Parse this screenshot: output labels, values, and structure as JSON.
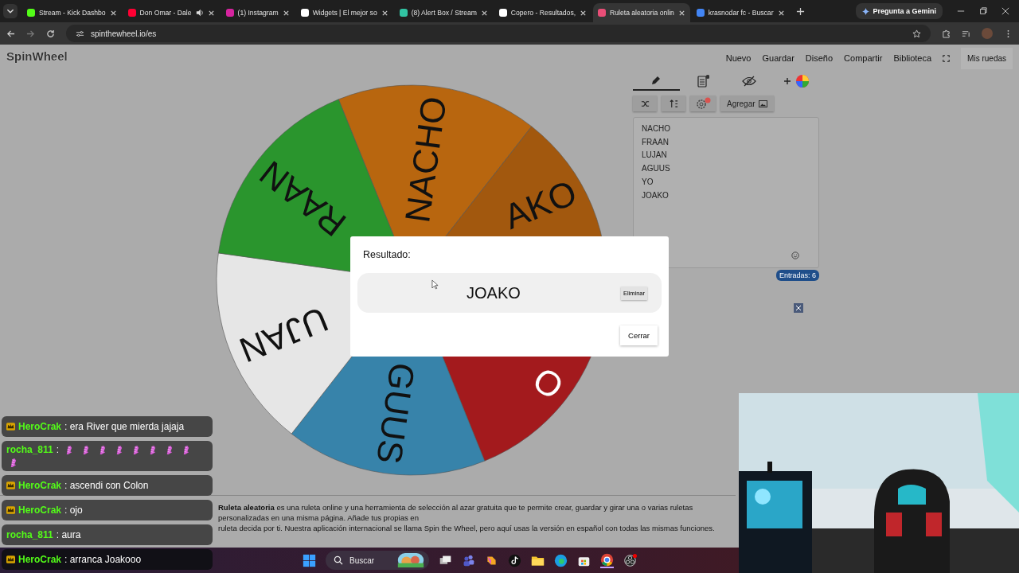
{
  "browser": {
    "tabs": [
      {
        "title": "Stream - Kick Dashbo",
        "selected": false
      },
      {
        "title": "Don Omar - Dale",
        "selected": false,
        "audio": true
      },
      {
        "title": "(1) Instagram",
        "selected": false
      },
      {
        "title": "Widgets | El mejor so",
        "selected": false
      },
      {
        "title": "(8) Alert Box / Stream",
        "selected": false
      },
      {
        "title": "Copero - Resultados,",
        "selected": false
      },
      {
        "title": "Ruleta aleatoria onlin",
        "selected": true
      },
      {
        "title": "krasnodar fc - Buscar",
        "selected": false
      }
    ],
    "gemini": "Pregunta a Gemini",
    "url": "spinthewheel.io/es"
  },
  "site": {
    "logo": "SpinWheel",
    "nav": [
      "Nuevo",
      "Guardar",
      "Diseño",
      "Compartir",
      "Biblioteca"
    ],
    "my_wheels": "Mis ruedas"
  },
  "wheel": {
    "slices": [
      {
        "label": "NACHO",
        "color": "#b8660f"
      },
      {
        "label": "AKO",
        "color": "#a2580e"
      },
      {
        "label": "O",
        "color": "#a31a1d"
      },
      {
        "label": "GUUS",
        "color": "#3783aa"
      },
      {
        "label": "UJAN",
        "color": "#e6e6e6"
      },
      {
        "label": "RAAN",
        "color": "#2a952d"
      }
    ]
  },
  "editor": {
    "add_button": "Agregar",
    "entries": [
      "NACHO",
      "FRAAN",
      "LUJAN",
      "AGUUS",
      "YO",
      "JOAKO"
    ],
    "count": "Entradas: 6"
  },
  "info": {
    "text": "**Ruleta aleatoria** es una ruleta online y una herramienta de selección al azar gratuita que te permite crear, guardar y girar una o varias ruletas personalizadas en una misma página. Añade tus propias en",
    "text2": "ruleta decida por ti. Nuestra aplicación internacional se llama Spin the Wheel, pero aquí usas la versión en español con todas las mismas funciones."
  },
  "dialog": {
    "title": "Resultado:",
    "result": "JOAKO",
    "remove": "Eliminar",
    "close": "Cerrar"
  },
  "chat": [
    {
      "user": "HeroCrak",
      "badge": true,
      "kind": "text",
      "text": ": era River que mierda jajaja"
    },
    {
      "user": "rocha_811",
      "badge": false,
      "kind": "emotes",
      "text": ":"
    },
    {
      "user": "HeroCrak",
      "badge": true,
      "kind": "text",
      "text": ": ascendi con Colon"
    },
    {
      "user": "HeroCrak",
      "badge": true,
      "kind": "text",
      "text": ": ojo"
    },
    {
      "user": "rocha_811",
      "badge": false,
      "kind": "text",
      "text": ": aura"
    },
    {
      "user": "HeroCrak",
      "badge": true,
      "kind": "text",
      "text": ": arranca Joakooo"
    }
  ],
  "taskbar": {
    "search": "Buscar"
  }
}
